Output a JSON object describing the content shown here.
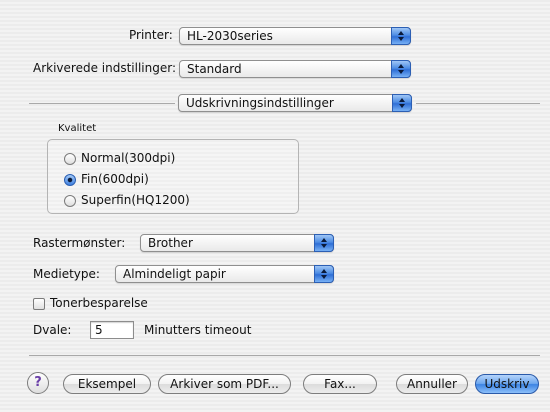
{
  "printer": {
    "label": "Printer:",
    "value": "HL-2030series"
  },
  "presets": {
    "label": "Arkiverede indstillinger:",
    "value": "Standard"
  },
  "panel_select": {
    "value": "Udskrivningsindstillinger"
  },
  "quality": {
    "label": "Kvalitet",
    "options": [
      {
        "label": "Normal(300dpi)",
        "selected": false
      },
      {
        "label": "Fin(600dpi)",
        "selected": true
      },
      {
        "label": "Superfin(HQ1200)",
        "selected": false
      }
    ]
  },
  "raster": {
    "label": "Rastermønster:",
    "value": "Brother"
  },
  "media": {
    "label": "Medietype:",
    "value": "Almindeligt papir"
  },
  "toner_save": {
    "label": "Tonerbesparelse",
    "checked": false
  },
  "sleep": {
    "label": "Dvale:",
    "value": "5",
    "suffix": "Minutters timeout"
  },
  "buttons": {
    "help": "?",
    "preview": "Eksempel",
    "save_pdf": "Arkiver som PDF...",
    "fax": "Fax...",
    "cancel": "Annuller",
    "print": "Udskriv"
  }
}
